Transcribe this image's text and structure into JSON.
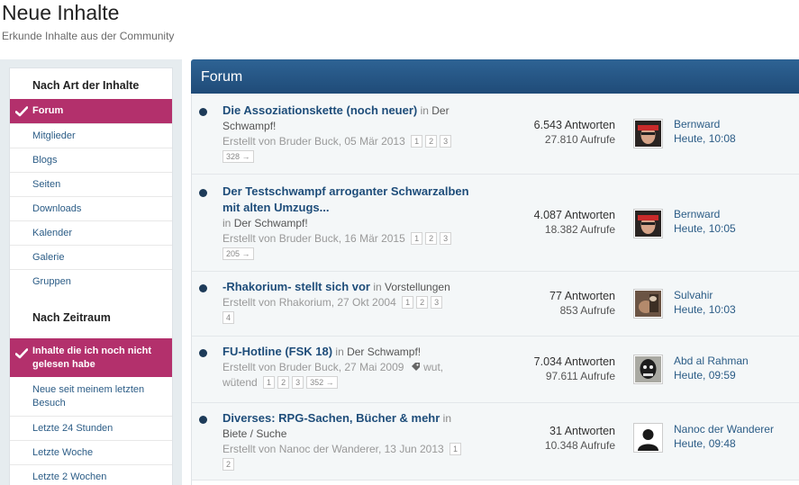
{
  "header": {
    "title": "Neue Inhalte",
    "subtitle": "Erkunde Inhalte aus der Community"
  },
  "sidebar": {
    "section1_title": "Nach Art der Inhalte",
    "type_items": [
      {
        "label": "Forum",
        "active": true
      },
      {
        "label": "Mitglieder"
      },
      {
        "label": "Blogs"
      },
      {
        "label": "Seiten"
      },
      {
        "label": "Downloads"
      },
      {
        "label": "Kalender"
      },
      {
        "label": "Galerie"
      },
      {
        "label": "Gruppen"
      }
    ],
    "section2_title": "Nach Zeitraum",
    "time_items": [
      {
        "label": "Inhalte die ich noch nicht gelesen habe",
        "active": true
      },
      {
        "label": "Neue seit meinem letzten Besuch"
      },
      {
        "label": "Letzte 24 Stunden"
      },
      {
        "label": "Letzte Woche"
      },
      {
        "label": "Letzte 2 Wochen"
      }
    ]
  },
  "main": {
    "section_title": "Forum",
    "in_word": "in",
    "topics": [
      {
        "title": "Die Assoziationskette (noch neuer)",
        "forum": "Der Schwampf!",
        "meta": "Erstellt von Bruder Buck, 05 Mär 2013",
        "pages": [
          "1",
          "2",
          "3",
          "328 →"
        ],
        "replies": "6.543 Antworten",
        "views": "27.810 Aufrufe",
        "last_user": "Bernward",
        "last_time": "Heute, 10:08"
      },
      {
        "title": "Der Testschwampf arroganter Schwarzalben mit alten Umzugs...",
        "forum": "Der Schwampf!",
        "meta": "Erstellt von Bruder Buck, 16 Mär 2015",
        "pages": [
          "1",
          "2",
          "3",
          "205 →"
        ],
        "replies": "4.087 Antworten",
        "views": "18.382 Aufrufe",
        "last_user": "Bernward",
        "last_time": "Heute, 10:05"
      },
      {
        "title": "-Rhakorium- stellt sich vor",
        "forum": "Vorstellungen",
        "meta": "Erstellt von Rhakorium, 27 Okt 2004",
        "pages": [
          "1",
          "2",
          "3",
          "4"
        ],
        "replies": "77 Antworten",
        "views": "853 Aufrufe",
        "last_user": "Sulvahir",
        "last_time": "Heute, 10:03"
      },
      {
        "title": "FU-Hotline (FSK 18)",
        "forum": "Der Schwampf!",
        "meta": "Erstellt von Bruder Buck, 27 Mai 2009",
        "tags": "wut, wütend",
        "pages": [
          "1",
          "2",
          "3",
          "352 →"
        ],
        "replies": "7.034 Antworten",
        "views": "97.611 Aufrufe",
        "last_user": "Abd al Rahman",
        "last_time": "Heute, 09:59"
      },
      {
        "title": "Diverses: RPG-Sachen, Bücher & mehr",
        "forum": "Biete / Suche",
        "meta": "Erstellt von Nanoc der Wanderer, 13 Jun 2013",
        "pages": [
          "1",
          "2"
        ],
        "replies": "31 Antworten",
        "views": "10.348 Aufrufe",
        "last_user": "Nanoc der Wanderer",
        "last_time": "Heute, 09:48"
      }
    ]
  },
  "icons": {
    "check": "check-icon",
    "tag": "tag-icon",
    "unread": "unread-dot-icon"
  },
  "colors": {
    "active_item": "#b3306c",
    "header_bar": "#2e6394",
    "link": "#1e4d7a"
  }
}
